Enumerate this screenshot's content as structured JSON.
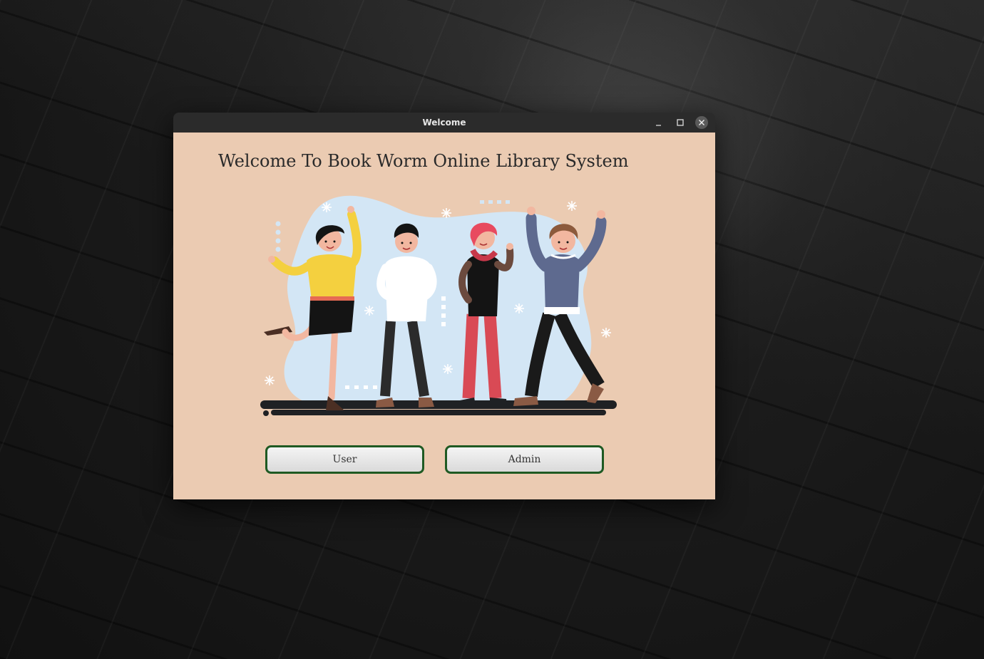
{
  "window": {
    "title": "Welcome",
    "controls": {
      "minimize_icon": "minimize-icon",
      "maximize_icon": "maximize-icon",
      "close_icon": "close-icon"
    }
  },
  "main": {
    "heading": "Welcome To Book Worm Online Library System",
    "illustration_icon": "people-celebrating-illustration",
    "buttons": {
      "user_label": "User",
      "admin_label": "Admin"
    }
  },
  "colors": {
    "window_background": "#ebcbb2",
    "titlebar": "#2b2b2b",
    "button_border": "#1f5a23",
    "illustration_blob": "#d3e6f5"
  }
}
